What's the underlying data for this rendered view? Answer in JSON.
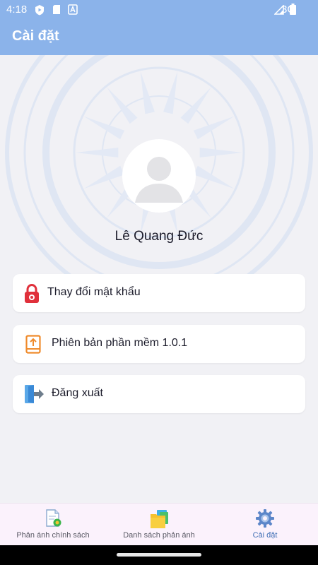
{
  "status_bar": {
    "time": "4:18",
    "network": "3G"
  },
  "app_bar": {
    "title": "Cài đặt"
  },
  "profile": {
    "name": "Lê Quang Đức"
  },
  "menu": [
    {
      "label": "Thay đổi mật khẩu",
      "icon": "lock-icon"
    },
    {
      "label": "Phiên bản phần mềm 1.0.1",
      "icon": "upload-book-icon"
    },
    {
      "label": "Đăng xuất",
      "icon": "logout-icon"
    }
  ],
  "bottom_nav": [
    {
      "label": "Phản ánh chính sách",
      "icon": "document-check-icon",
      "active": false
    },
    {
      "label": "Danh sách phản ánh",
      "icon": "folder-list-icon",
      "active": false
    },
    {
      "label": "Cài đặt",
      "icon": "gear-icon",
      "active": true
    }
  ],
  "colors": {
    "app_bar": "#8bb3ea",
    "background": "#f1f1f5",
    "active_nav": "#3f6fb5",
    "lock_red": "#e0303b"
  }
}
